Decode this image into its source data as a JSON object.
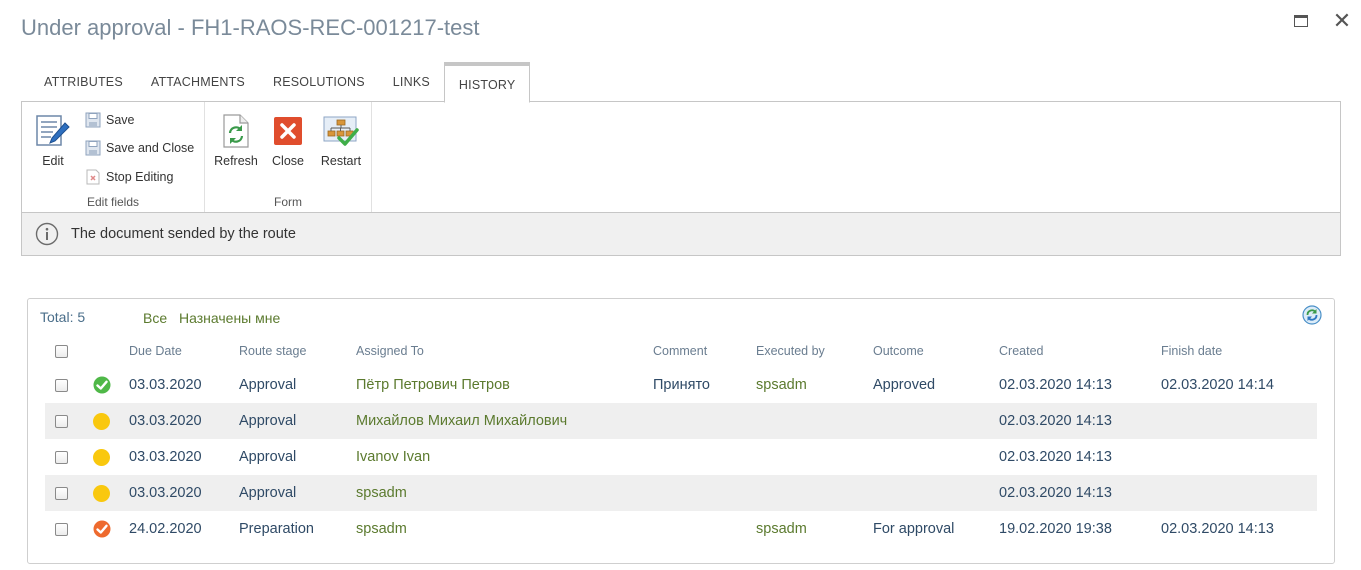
{
  "window": {
    "title": "Under approval - FH1-RAOS-REC-001217-test",
    "maximize_icon": "maximize-icon",
    "close_glyph": "✕"
  },
  "tabs": [
    {
      "label": "ATTRIBUTES",
      "active": false
    },
    {
      "label": "ATTACHMENTS",
      "active": false
    },
    {
      "label": "RESOLUTIONS",
      "active": false
    },
    {
      "label": "LINKS",
      "active": false
    },
    {
      "label": "HISTORY",
      "active": true
    }
  ],
  "ribbon": {
    "edit_group": {
      "label": "Edit fields",
      "edit": "Edit",
      "save": "Save",
      "save_close": "Save and Close",
      "stop_editing": "Stop Editing"
    },
    "form_group": {
      "label": "Form",
      "refresh": "Refresh",
      "close": "Close",
      "restart": "Restart"
    }
  },
  "status": {
    "icon": "info-icon",
    "text": "The document sended by the route"
  },
  "history": {
    "total": "Total: 5",
    "filter_all": "Все",
    "filter_mine": "Назначены мне",
    "columns": {
      "due_date": "Due Date",
      "route_stage": "Route stage",
      "assigned_to": "Assigned To",
      "comment": "Comment",
      "executed_by": "Executed by",
      "outcome": "Outcome",
      "created": "Created",
      "finish_date": "Finish date"
    },
    "rows": [
      {
        "status": "approved",
        "due_date": "03.03.2020",
        "route_stage": "Approval",
        "assigned_to": "Пётр Петрович Петров",
        "comment": "Принято",
        "executed_by": "spsadm",
        "outcome": "Approved",
        "created": "02.03.2020 14:13",
        "finish_date": "02.03.2020 14:14"
      },
      {
        "status": "pending",
        "due_date": "03.03.2020",
        "route_stage": "Approval",
        "assigned_to": "Михайлов Михаил Михайлович",
        "comment": "",
        "executed_by": "",
        "outcome": "",
        "created": "02.03.2020 14:13",
        "finish_date": ""
      },
      {
        "status": "pending",
        "due_date": "03.03.2020",
        "route_stage": "Approval",
        "assigned_to": "Ivanov Ivan",
        "comment": "",
        "executed_by": "",
        "outcome": "",
        "created": "02.03.2020 14:13",
        "finish_date": ""
      },
      {
        "status": "pending",
        "due_date": "03.03.2020",
        "route_stage": "Approval",
        "assigned_to": "spsadm",
        "comment": "",
        "executed_by": "",
        "outcome": "",
        "created": "02.03.2020 14:13",
        "finish_date": ""
      },
      {
        "status": "completed",
        "due_date": "24.02.2020",
        "route_stage": "Preparation",
        "assigned_to": "spsadm",
        "comment": "",
        "executed_by": "spsadm",
        "outcome": "For approval",
        "created": "19.02.2020 19:38",
        "finish_date": "02.03.2020 14:13"
      }
    ]
  },
  "colors": {
    "approved": "#4fb848",
    "pending": "#f9c80e",
    "completed": "#ee6a2e",
    "link": "#5b7a2e",
    "title": "#7a8a99"
  }
}
